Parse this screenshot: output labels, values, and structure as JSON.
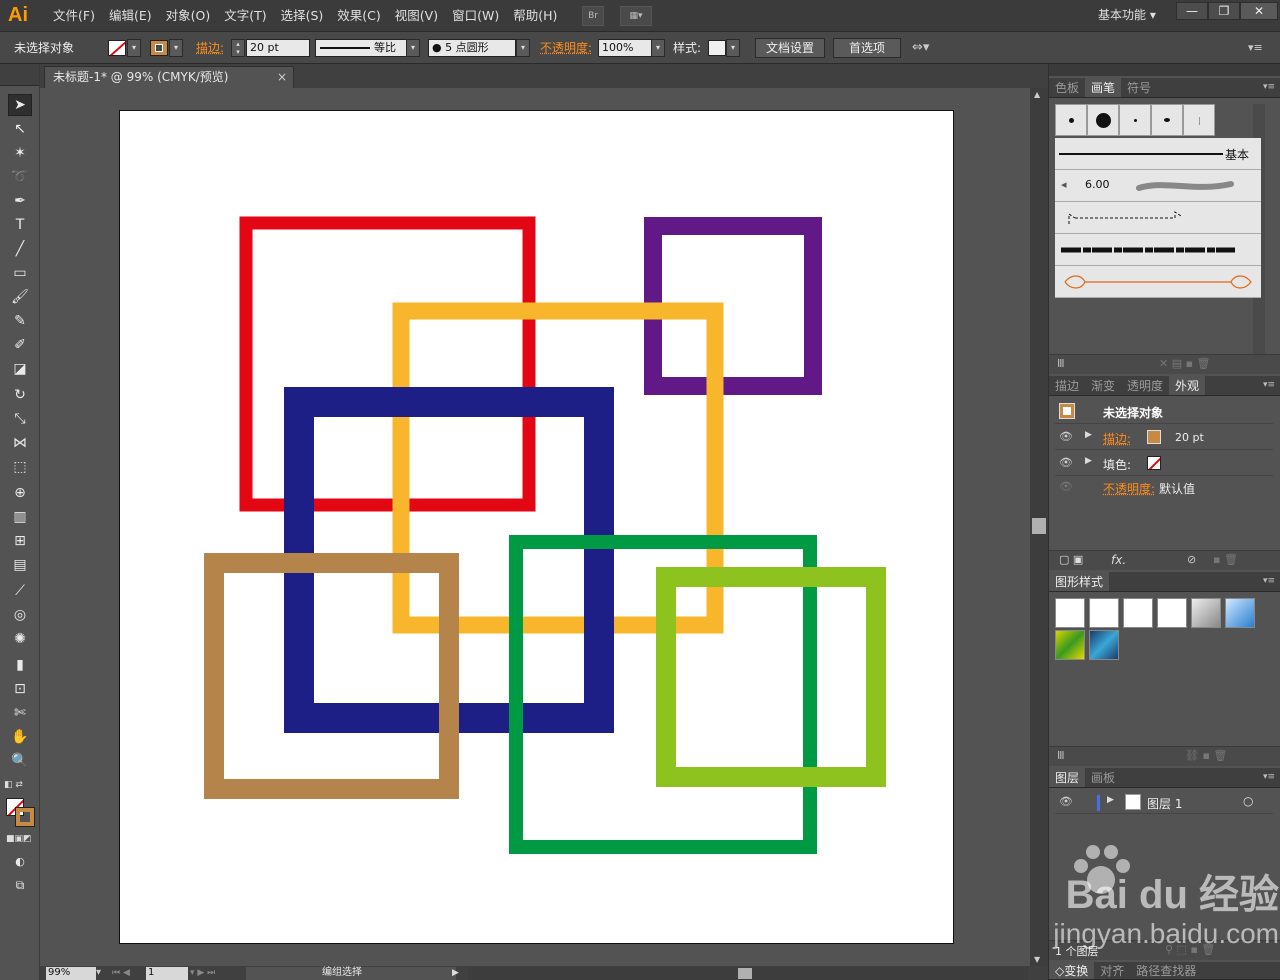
{
  "app": {
    "logo": "Ai"
  },
  "menu": [
    "文件(F)",
    "编辑(E)",
    "对象(O)",
    "文字(T)",
    "选择(S)",
    "效果(C)",
    "视图(V)",
    "窗口(W)",
    "帮助(H)"
  ],
  "menubar_buttons": {
    "bridge": "Br",
    "arrange": "▦▾"
  },
  "workspace": {
    "label": "基本功能",
    "minimize": "—",
    "restore": "❐",
    "close": "✕"
  },
  "control": {
    "selection_label": "未选择对象",
    "stroke_label": "描边:",
    "stroke_weight": "20 pt",
    "profile_label": "等比",
    "brush_label": "● 5 点圆形",
    "opacity_label": "不透明度:",
    "opacity_value": "100%",
    "style_label": "样式:",
    "doc_setup_button": "文档设置",
    "preferences_button": "首选项"
  },
  "document": {
    "tab_title": "未标题-1* @ 99% (CMYK/预览)",
    "tab_close": "×"
  },
  "status": {
    "zoom": "99%",
    "artboard": "1",
    "mode": "编组选择"
  },
  "brush_panel": {
    "tabs": [
      "色板",
      "画笔",
      "符号"
    ],
    "active_tab": "画笔",
    "basic_label": "基本",
    "calligraphy_size": "6.00"
  },
  "appearance_panel": {
    "tabs": [
      "描边",
      "渐变",
      "透明度",
      "外观"
    ],
    "active_tab": "外观",
    "title": "未选择对象",
    "stroke_label": "描边:",
    "stroke_value": "20 pt",
    "fill_label": "填色:",
    "opacity_label": "不透明度:",
    "opacity_value": "默认值",
    "fx_label": "fx."
  },
  "graphic_styles_panel": {
    "tabs": [
      "图形样式"
    ],
    "active_tab": "图形样式"
  },
  "layers_panel": {
    "tabs": [
      "图层",
      "画板"
    ],
    "active_tab": "图层",
    "layer_name": "图层 1",
    "layer_count": "1 个图层"
  },
  "bottom_tabs": [
    "变换",
    "对齐",
    "路径查找器"
  ],
  "watermark": {
    "brand": "Bai du 经验",
    "url": "jingyan.baidu.com"
  },
  "artwork": {
    "description_free": true,
    "squares": [
      {
        "name": "red-square",
        "color": "#e30613"
      },
      {
        "name": "purple-square",
        "color": "#611987"
      },
      {
        "name": "yellow-square",
        "color": "#f7b62b"
      },
      {
        "name": "navy-square",
        "color": "#1e1e87"
      },
      {
        "name": "brown-square",
        "color": "#b5844a"
      },
      {
        "name": "green-square",
        "color": "#009a44"
      },
      {
        "name": "lime-square",
        "color": "#8ec21f"
      }
    ]
  },
  "colors": {
    "accent_orange": "#ff8c1a",
    "stroke_swatch": "#c68a45",
    "layer_color": "#4a6fe0"
  }
}
